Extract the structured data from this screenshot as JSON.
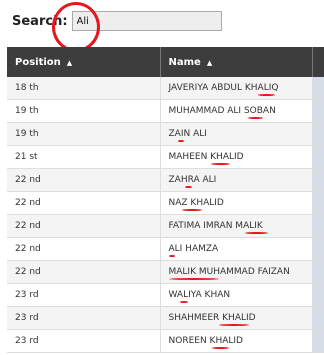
{
  "search": {
    "label": "Search:",
    "value": "Ali"
  },
  "table": {
    "columns": [
      "Position",
      "Name"
    ],
    "rows": [
      {
        "position": "18 th",
        "name": "JAVERIYA ABDUL KHALIQ"
      },
      {
        "position": "19 th",
        "name": "MUHAMMAD ALI SOBAN"
      },
      {
        "position": "19 th",
        "name": "ZAIN ALI"
      },
      {
        "position": "21 st",
        "name": "MAHEEN KHALID"
      },
      {
        "position": "22 nd",
        "name": "ZAHRA ALI"
      },
      {
        "position": "22 nd",
        "name": "NAZ KHALID"
      },
      {
        "position": "22 nd",
        "name": "FATIMA IMRAN MALIK"
      },
      {
        "position": "22 nd",
        "name": "ALI HAMZA"
      },
      {
        "position": "22 nd",
        "name": "MALIK MUHAMMAD FAIZAN"
      },
      {
        "position": "23 rd",
        "name": "WALIYA KHAN"
      },
      {
        "position": "23 rd",
        "name": "SHAHMEER KHALID"
      },
      {
        "position": "23 rd",
        "name": "NOREEN KHALID"
      }
    ]
  },
  "colors": {
    "header_bg": "#3d3d3d",
    "annotation": "#e8161c",
    "input_bg": "#eeeeee"
  },
  "icons": {
    "sort": "sort-up-icon"
  }
}
